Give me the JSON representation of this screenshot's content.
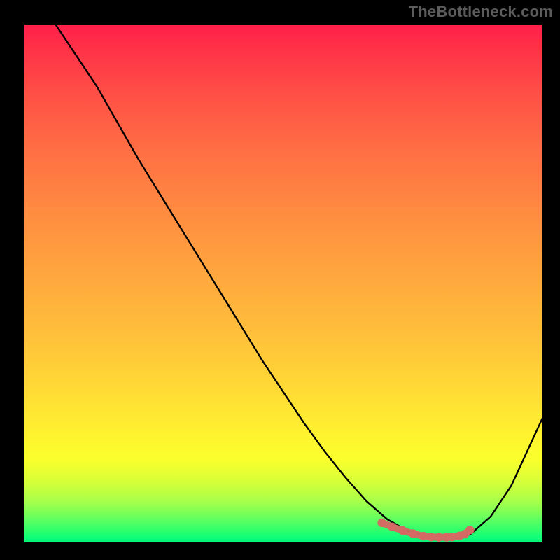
{
  "watermark": "TheBottleneck.com",
  "chart_data": {
    "type": "line",
    "title": "",
    "xlabel": "",
    "ylabel": "",
    "xlim": [
      0,
      100
    ],
    "ylim": [
      0,
      100
    ],
    "grid": false,
    "legend": false,
    "series": [
      {
        "name": "bottleneck-curve",
        "color": "#000000",
        "x": [
          6,
          10,
          14,
          18,
          22,
          26,
          30,
          34,
          38,
          42,
          46,
          50,
          54,
          58,
          62,
          66,
          70,
          74,
          78,
          80,
          82,
          86,
          90,
          94,
          100
        ],
        "y": [
          100,
          94,
          88,
          81,
          74,
          67.5,
          61,
          54.5,
          48,
          41.5,
          35,
          29,
          23,
          17.5,
          12.5,
          8,
          4.5,
          2.2,
          1.1,
          1,
          1,
          1.5,
          5,
          11,
          24
        ]
      }
    ],
    "highlight": {
      "name": "optimal-zone-dots",
      "color": "#d36a63",
      "x": [
        69,
        71,
        73,
        75,
        77,
        78.5,
        80,
        81.5,
        82.5,
        84,
        85,
        86
      ],
      "y": [
        3.8,
        3.0,
        2.3,
        1.7,
        1.2,
        1.05,
        1.0,
        1.0,
        1.05,
        1.25,
        1.6,
        2.4
      ]
    },
    "gradient_stops": [
      {
        "pos": 0,
        "color": "#ff1f4a"
      },
      {
        "pos": 0.5,
        "color": "#ffb43c"
      },
      {
        "pos": 0.8,
        "color": "#fff22f"
      },
      {
        "pos": 0.95,
        "color": "#6cff5c"
      },
      {
        "pos": 1.0,
        "color": "#05f07a"
      }
    ]
  }
}
